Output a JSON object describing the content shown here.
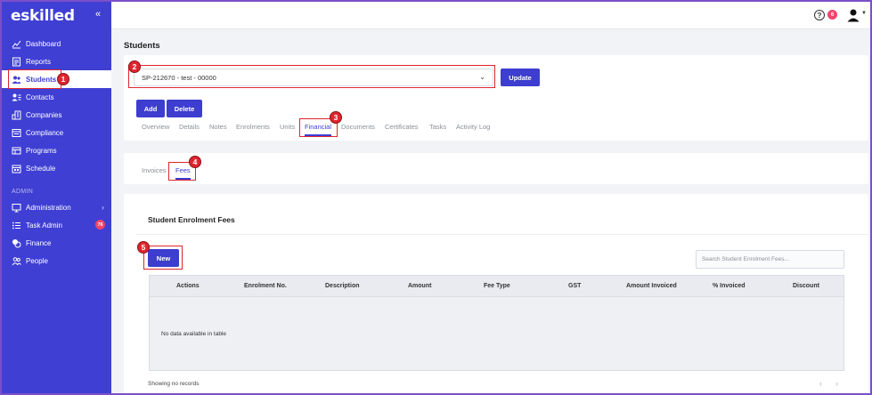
{
  "sidebar": {
    "brand": "eskilled",
    "collapse_icon": "«",
    "items": [
      {
        "label": "Dashboard",
        "icon": "chart-line-icon"
      },
      {
        "label": "Reports",
        "icon": "report-icon"
      },
      {
        "label": "Students",
        "icon": "users-icon"
      },
      {
        "label": "Contacts",
        "icon": "contacts-icon"
      },
      {
        "label": "Companies",
        "icon": "building-icon"
      },
      {
        "label": "Compliance",
        "icon": "compliance-icon"
      },
      {
        "label": "Programs",
        "icon": "programs-icon"
      },
      {
        "label": "Schedule",
        "icon": "calendar-icon"
      }
    ],
    "admin_label": "ADMIN",
    "admin_items": [
      {
        "label": "Administration",
        "icon": "monitor-icon"
      },
      {
        "label": "Task Admin",
        "icon": "list-icon",
        "badge": "76"
      },
      {
        "label": "Finance",
        "icon": "coins-icon"
      },
      {
        "label": "People",
        "icon": "people-icon"
      }
    ],
    "colors": {
      "background": "#3f3fd4",
      "active_text": "#3f3fd4"
    }
  },
  "topbar": {
    "help_icon": "?",
    "notification_count": "6",
    "avatar_icon": "user-icon"
  },
  "page": {
    "title": "Students",
    "student_select": "SP-212670 - test - 00000",
    "update_label": "Update",
    "add_label": "Add",
    "delete_label": "Delete",
    "tabs": [
      "Overview",
      "Details",
      "Notes",
      "Enrolments",
      "Units",
      "Financial",
      "Documents",
      "Certificates",
      "Tasks",
      "Activity Log"
    ],
    "active_tab": "Financial",
    "subtabs": [
      "Invoices",
      "Fees"
    ],
    "active_subtab": "Fees"
  },
  "fees": {
    "section_title": "Student Enrolment Fees",
    "new_label": "New",
    "search_placeholder": "Search Student Enrolment Fees...",
    "columns": [
      "Actions",
      "Enrolment No.",
      "Description",
      "Amount",
      "Fee Type",
      "GST",
      "Amount Invoiced",
      "% Invoiced",
      "Discount"
    ],
    "empty_text": "No data available in table",
    "footer_text": "Showing no records",
    "pager_prev": "‹",
    "pager_next": "›"
  },
  "annotations": [
    "1",
    "2",
    "3",
    "4",
    "5"
  ],
  "accent_color": "#3d3dcf",
  "highlight_color": "#e0252f"
}
